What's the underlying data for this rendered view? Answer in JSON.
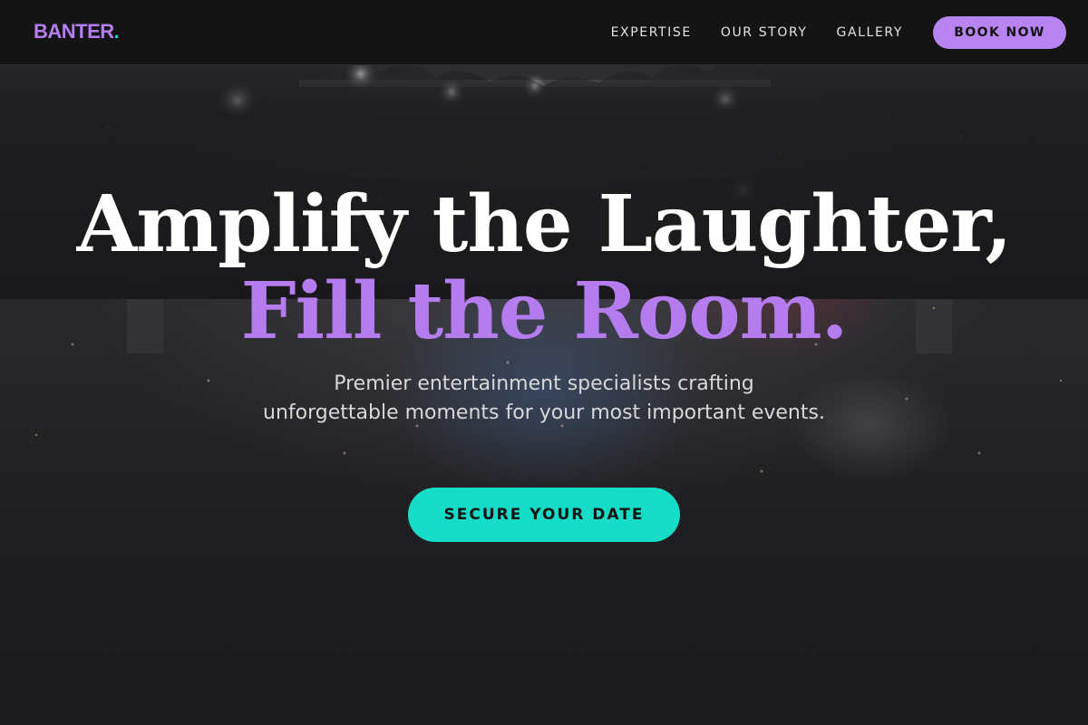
{
  "brand": {
    "name": "BANTER",
    "dot": ".",
    "color": "#b57ef0",
    "dot_color": "#14d9c4"
  },
  "nav": {
    "links": [
      {
        "label": "EXPERTISE"
      },
      {
        "label": "OUR STORY"
      },
      {
        "label": "GALLERY"
      }
    ],
    "book_label": "BOOK NOW"
  },
  "hero": {
    "headline_line1": "Amplify the Laughter,",
    "headline_line2": "Fill the Room.",
    "subtitle": "Premier entertainment specialists crafting unforgettable moments for your most important events.",
    "cta_label": "SECURE YOUR DATE",
    "background": "concert-crowd-photo"
  },
  "colors": {
    "accent_purple": "#b784f2",
    "accent_teal": "#14dcc6",
    "nav_background": "#141414"
  }
}
